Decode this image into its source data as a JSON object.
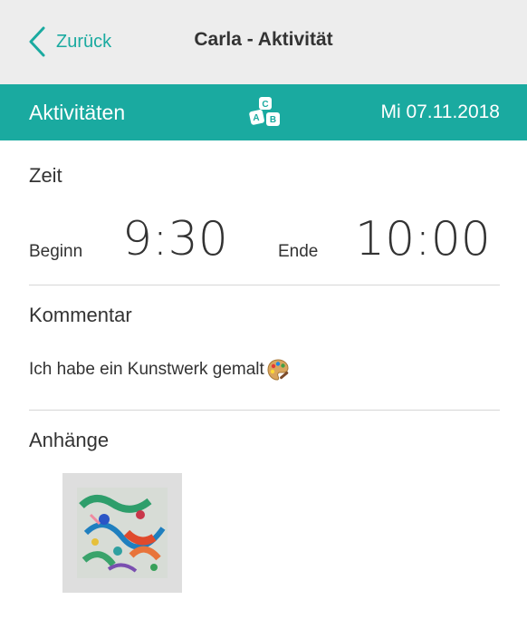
{
  "header": {
    "back_label": "Zurück",
    "title": "Carla - Aktivität"
  },
  "activity_bar": {
    "label": "Aktivitäten",
    "date": "Mi 07.11.2018",
    "icon": "abc-blocks-icon"
  },
  "time": {
    "section_label": "Zeit",
    "begin_label": "Beginn",
    "begin_value": "9:30",
    "end_label": "Ende",
    "end_value": "10:00"
  },
  "comment": {
    "section_label": "Kommentar",
    "text": "Ich habe ein Kunstwerk gemalt",
    "emoji": "artist-palette-icon"
  },
  "attachments": {
    "section_label": "Anhänge",
    "items": [
      {
        "type": "image",
        "description_icon": "painting-thumbnail"
      }
    ]
  },
  "colors": {
    "accent": "#1aaaa0",
    "header_bg": "#ededed",
    "divider": "#d6d6d6",
    "text": "#333333"
  }
}
